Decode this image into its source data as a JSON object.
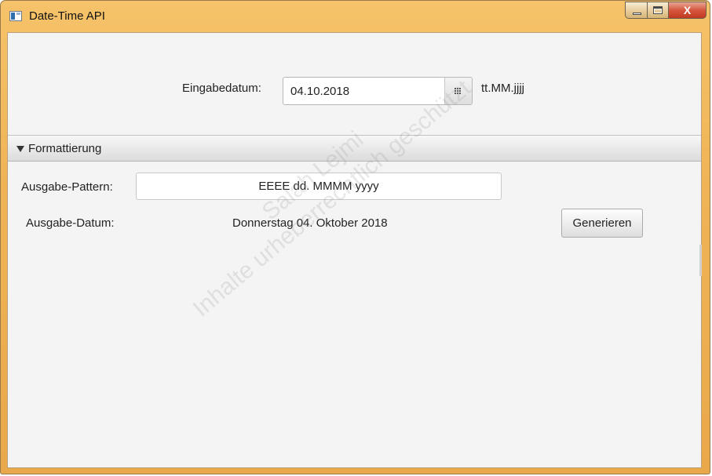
{
  "window": {
    "title": "Date-Time API",
    "controls": {
      "minimize_icon": "minimize-icon",
      "maximize_icon": "maximize-icon",
      "close_label": "X"
    }
  },
  "input_row": {
    "label": "Eingabedatum:",
    "date_value": "04.10.2018",
    "calendar_icon": "calendar-icon",
    "format_hint": "tt.MM.jjjj"
  },
  "formatting_pane": {
    "title": "Formattierung",
    "expanded": true,
    "pattern_label": "Ausgabe-Pattern:",
    "pattern_value": "EEEE dd. MMMM yyyy",
    "output_label": "Ausgabe-Datum:",
    "output_value": "Donnerstag 04. Oktober 2018",
    "generate_button": "Generieren"
  },
  "watermark": {
    "line1": "Salah Lejmi",
    "line2": "Inhalte urheberrechtlich geschützt"
  },
  "colors": {
    "title_bar": "#f0b558",
    "close_button": "#c9452b",
    "client_background": "#f4f4f4"
  }
}
